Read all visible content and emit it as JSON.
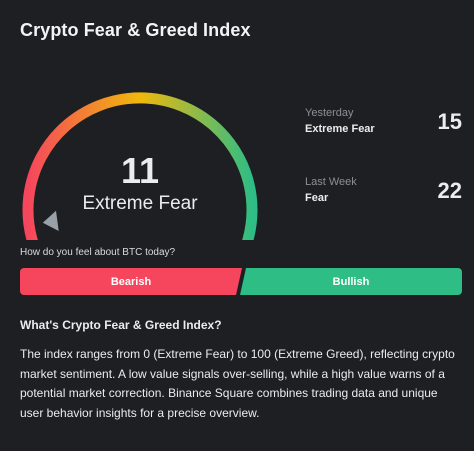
{
  "title": "Crypto Fear & Greed Index",
  "gauge": {
    "value": 11,
    "value_text": "11",
    "label": "Extreme Fear",
    "min": 0,
    "max": 100,
    "colors": [
      "#f6465d",
      "#f0b90b",
      "#2ebd85"
    ],
    "needle_color": "#9aa0a8"
  },
  "stats": [
    {
      "name": "Yesterday",
      "classification": "Extreme Fear",
      "value": "15"
    },
    {
      "name": "Last Week",
      "classification": "Fear",
      "value": "22"
    }
  ],
  "vote": {
    "question": "How do you feel about BTC today?",
    "bearish_label": "Bearish",
    "bullish_label": "Bullish",
    "bearish_color": "#f6465d",
    "bullish_color": "#2ebd85"
  },
  "info": {
    "heading": "What's Crypto Fear & Greed Index?",
    "body": "The index ranges from 0 (Extreme Fear) to 100 (Extreme Greed), reflecting crypto market sentiment. A low value signals over-selling, while a high value warns of a potential market correction. Binance Square combines trading data and unique user behavior insights for a precise overview."
  }
}
